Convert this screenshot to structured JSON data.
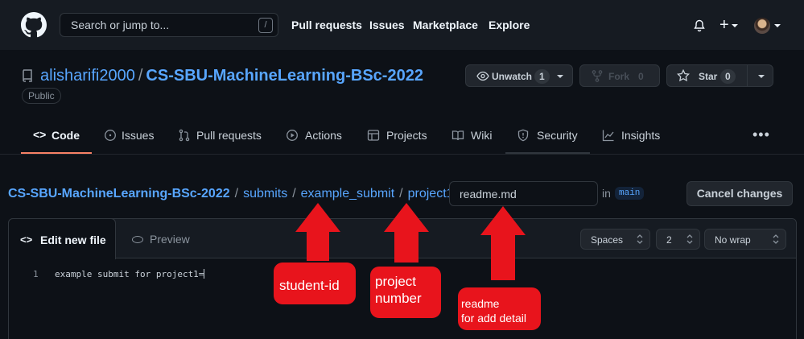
{
  "header": {
    "search_placeholder": "Search or jump to...",
    "search_key": "/",
    "nav": [
      "Pull requests",
      "Issues",
      "Marketplace",
      "Explore"
    ],
    "plus": "+"
  },
  "repo": {
    "owner": "alisharifi2000",
    "separator": "/",
    "name": "CS-SBU-MachineLearning-BSc-2022",
    "visibility": "Public",
    "watch_label": "Unwatch",
    "watch_count": "1",
    "fork_label": "Fork",
    "fork_count": "0",
    "star_label": "Star",
    "star_count": "0"
  },
  "tabs": [
    "Code",
    "Issues",
    "Pull requests",
    "Actions",
    "Projects",
    "Wiki",
    "Security",
    "Insights"
  ],
  "breadcrumb": {
    "root": "CS-SBU-MachineLearning-BSc-2022",
    "parts": [
      "submits",
      "example_submit",
      "project1"
    ],
    "sep": "/",
    "filename": "readme.md",
    "in_text": "in",
    "branch": "main",
    "cancel_label": "Cancel changes"
  },
  "editor": {
    "edit_tab": "Edit new file",
    "preview_tab": "Preview",
    "indent_mode": "Spaces",
    "indent_size": "2",
    "wrap_mode": "No wrap",
    "line_number": "1",
    "code": "example submit for project1="
  },
  "annotations": {
    "student_id": "student-id",
    "project_number": "project\nnumber",
    "readme": "readme\nfor add detail"
  },
  "colors": {
    "annotation_red": "#e8141c",
    "link_blue": "#58a6ff",
    "active_tab_underline": "#f78166"
  }
}
